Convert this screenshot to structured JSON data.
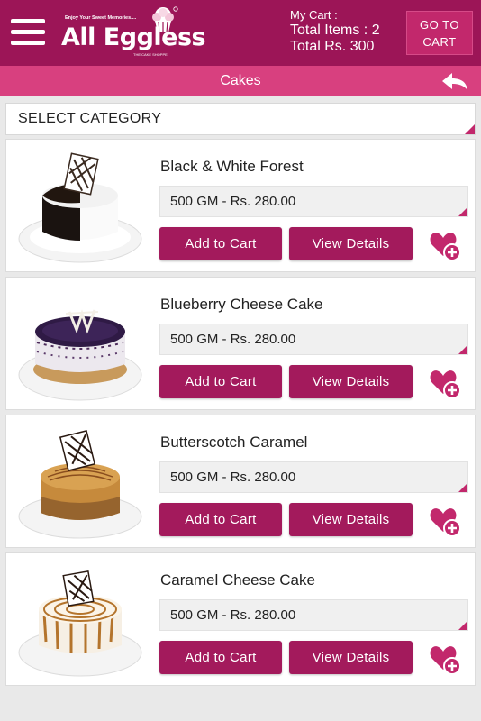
{
  "header": {
    "logo": {
      "tagline": "Enjoy Your Sweet Memories....",
      "name": "All Eggless",
      "sub": "THE CAKE SHOPPE"
    },
    "cart": {
      "label": "My Cart  :",
      "total_items_text": "Total Items :  2",
      "total_amount_text": "Total Rs. 300"
    },
    "goto_cart_line1": "GO TO",
    "goto_cart_line2": "CART",
    "menu_icon": "hamburger-menu-icon"
  },
  "subheader": {
    "title": "Cakes",
    "back_icon": "back-arrow-icon"
  },
  "category_select": {
    "label": "SELECT CATEGORY"
  },
  "buttons": {
    "add_to_cart": "Add to Cart",
    "view_details": "View Details"
  },
  "products": [
    {
      "name": "Black & White Forest",
      "variant": "500 GM - Rs. 280.00",
      "image_icon": "black-white-forest-cake-image"
    },
    {
      "name": "Blueberry Cheese Cake",
      "variant": "500 GM - Rs. 280.00",
      "image_icon": "blueberry-cheese-cake-image"
    },
    {
      "name": "Butterscotch Caramel",
      "variant": "500 GM - Rs. 280.00",
      "image_icon": "butterscotch-caramel-cake-image"
    },
    {
      "name": "Caramel Cheese Cake",
      "variant": "500 GM - Rs. 280.00",
      "image_icon": "caramel-cheese-cake-image"
    }
  ],
  "colors": {
    "primary": "#9c1557",
    "accent": "#d8407f",
    "button": "#a31a5c"
  }
}
